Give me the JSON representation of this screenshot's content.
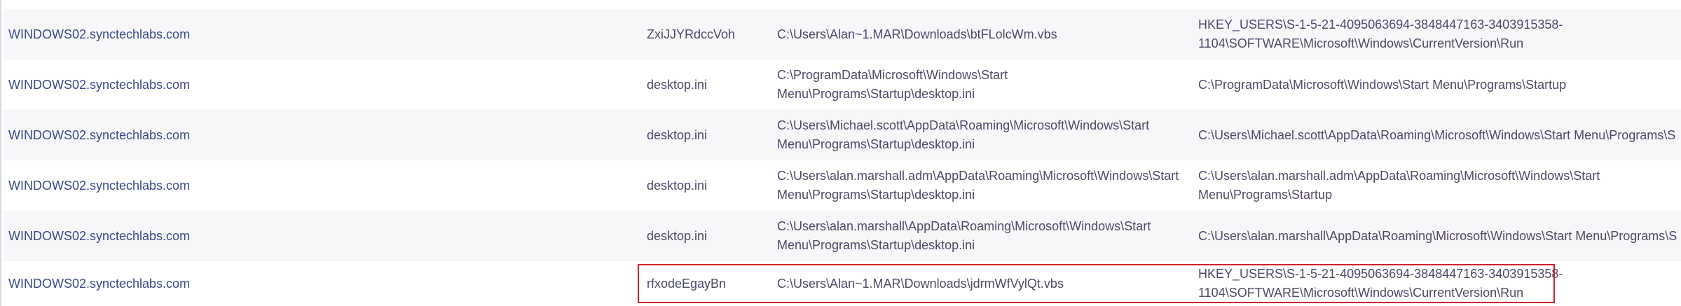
{
  "rows": [
    {
      "host": "WINDOWS02.synctechlabs.com",
      "name": "ZxiJJYRdccVoh",
      "path": "C:\\Users\\Alan~1.MAR\\Downloads\\btFLolcWm.vbs",
      "location": "HKEY_USERS\\S-1-5-21-4095063694-3848447163-3403915358-\n1104\\SOFTWARE\\Microsoft\\Windows\\CurrentVersion\\Run"
    },
    {
      "host": "WINDOWS02.synctechlabs.com",
      "name": "desktop.ini",
      "path": "C:\\ProgramData\\Microsoft\\Windows\\Start\nMenu\\Programs\\Startup\\desktop.ini",
      "location": "C:\\ProgramData\\Microsoft\\Windows\\Start Menu\\Programs\\Startup"
    },
    {
      "host": "WINDOWS02.synctechlabs.com",
      "name": "desktop.ini",
      "path": "C:\\Users\\Michael.scott\\AppData\\Roaming\\Microsoft\\Windows\\Start\nMenu\\Programs\\Startup\\desktop.ini",
      "location": "C:\\Users\\Michael.scott\\AppData\\Roaming\\Microsoft\\Windows\\Start Menu\\Programs\\S"
    },
    {
      "host": "WINDOWS02.synctechlabs.com",
      "name": "desktop.ini",
      "path": "C:\\Users\\alan.marshall.adm\\AppData\\Roaming\\Microsoft\\Windows\\Start\nMenu\\Programs\\Startup\\desktop.ini",
      "location": "C:\\Users\\alan.marshall.adm\\AppData\\Roaming\\Microsoft\\Windows\\Start\nMenu\\Programs\\Startup"
    },
    {
      "host": "WINDOWS02.synctechlabs.com",
      "name": "desktop.ini",
      "path": "C:\\Users\\alan.marshall\\AppData\\Roaming\\Microsoft\\Windows\\Start\nMenu\\Programs\\Startup\\desktop.ini",
      "location": "C:\\Users\\alan.marshall\\AppData\\Roaming\\Microsoft\\Windows\\Start Menu\\Programs\\S"
    },
    {
      "host": "WINDOWS02.synctechlabs.com",
      "name": "rfxodeEgayBn",
      "path": "C:\\Users\\Alan~1.MAR\\Downloads\\jdrmWfVylQt.vbs",
      "location": "HKEY_USERS\\S-1-5-21-4095063694-3848447163-3403915358-\n1104\\SOFTWARE\\Microsoft\\Windows\\CurrentVersion\\Run"
    }
  ],
  "colors": {
    "highlight_border": "#d0202a",
    "row_alt_bg": "#f7f7f9",
    "host_text": "#3b4a8a"
  }
}
